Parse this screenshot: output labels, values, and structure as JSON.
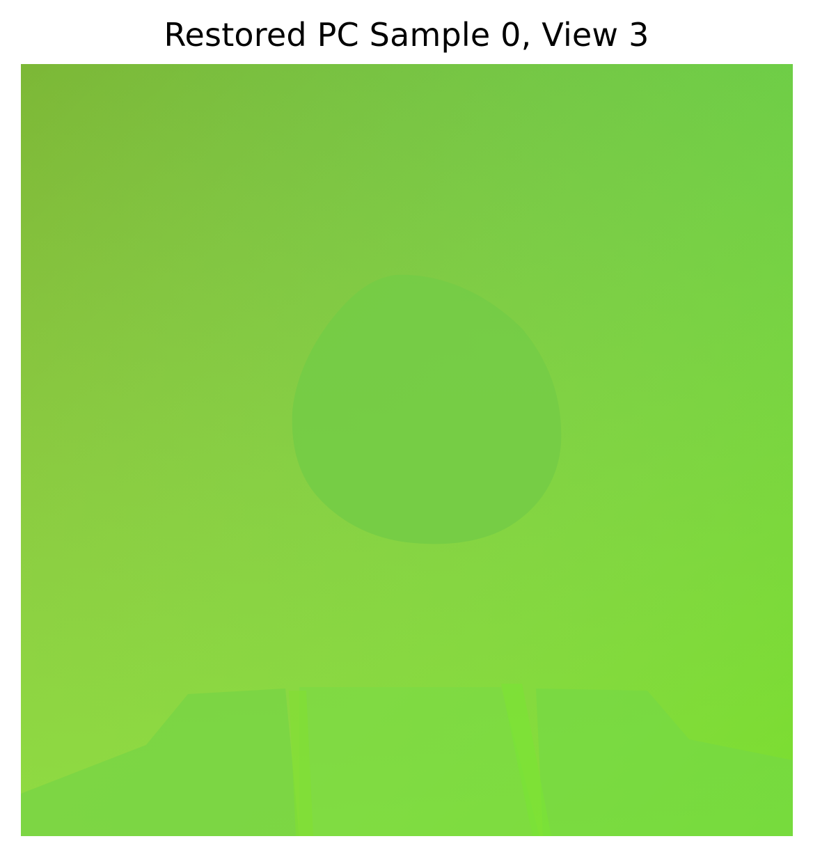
{
  "figure": {
    "title": "Restored PC Sample 0, View 3"
  },
  "colors": {
    "background": "#ffffff",
    "title_text": "#000000",
    "gradient_top_left": "#7cb836",
    "gradient_top_right": "#5fc536",
    "gradient_bottom_left": "#8dd42f",
    "gradient_bottom_right": "#6ee830",
    "head_region": "#74cc46",
    "shoulder_region": "#77d845",
    "neck_region": "#79dc3c"
  }
}
